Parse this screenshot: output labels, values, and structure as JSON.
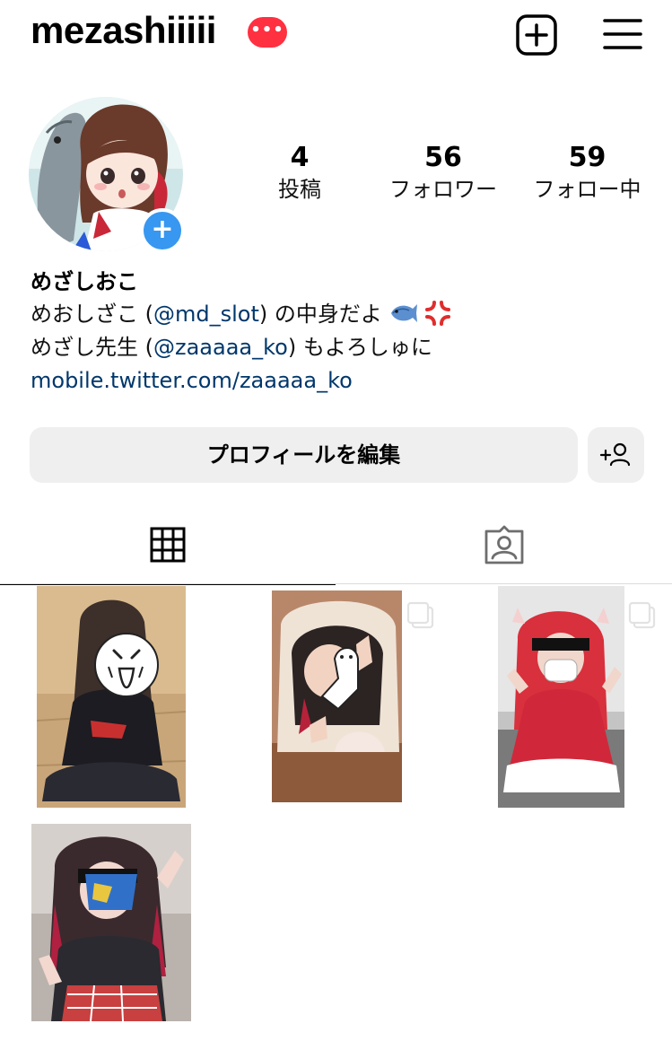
{
  "header": {
    "username": "mezashiiiii",
    "badge": "•••",
    "icons": [
      "new-post-icon",
      "menu-icon"
    ]
  },
  "profile": {
    "stats": [
      {
        "number": "4",
        "label": "投稿"
      },
      {
        "number": "56",
        "label": "フォロワー"
      },
      {
        "number": "59",
        "label": "フォロー中"
      }
    ],
    "display_name": "めざしおこ",
    "bio": {
      "line1_prefix": "めおしざこ (",
      "line1_mention": "@md_slot",
      "line1_suffix": ") の中身だよ",
      "line2_prefix": "めざし先生 (",
      "line2_mention": "@zaaaaa_ko",
      "line2_suffix": ") もよろしゅに",
      "link": "mobile.twitter.com/zaaaaa_ko"
    }
  },
  "buttons": {
    "edit_profile": "プロフィールを編集"
  },
  "tabs": [
    {
      "icon": "grid-icon",
      "active": true
    },
    {
      "icon": "tagged-icon",
      "active": false
    }
  ],
  "posts": [
    {
      "id": 1,
      "multi": false
    },
    {
      "id": 2,
      "multi": true
    },
    {
      "id": 3,
      "multi": true
    },
    {
      "id": 4,
      "multi": false
    }
  ],
  "colors": {
    "badge": "#ff3040",
    "link": "#00376b",
    "add_avatar": "#3897f0",
    "button_bg": "#efefef"
  }
}
